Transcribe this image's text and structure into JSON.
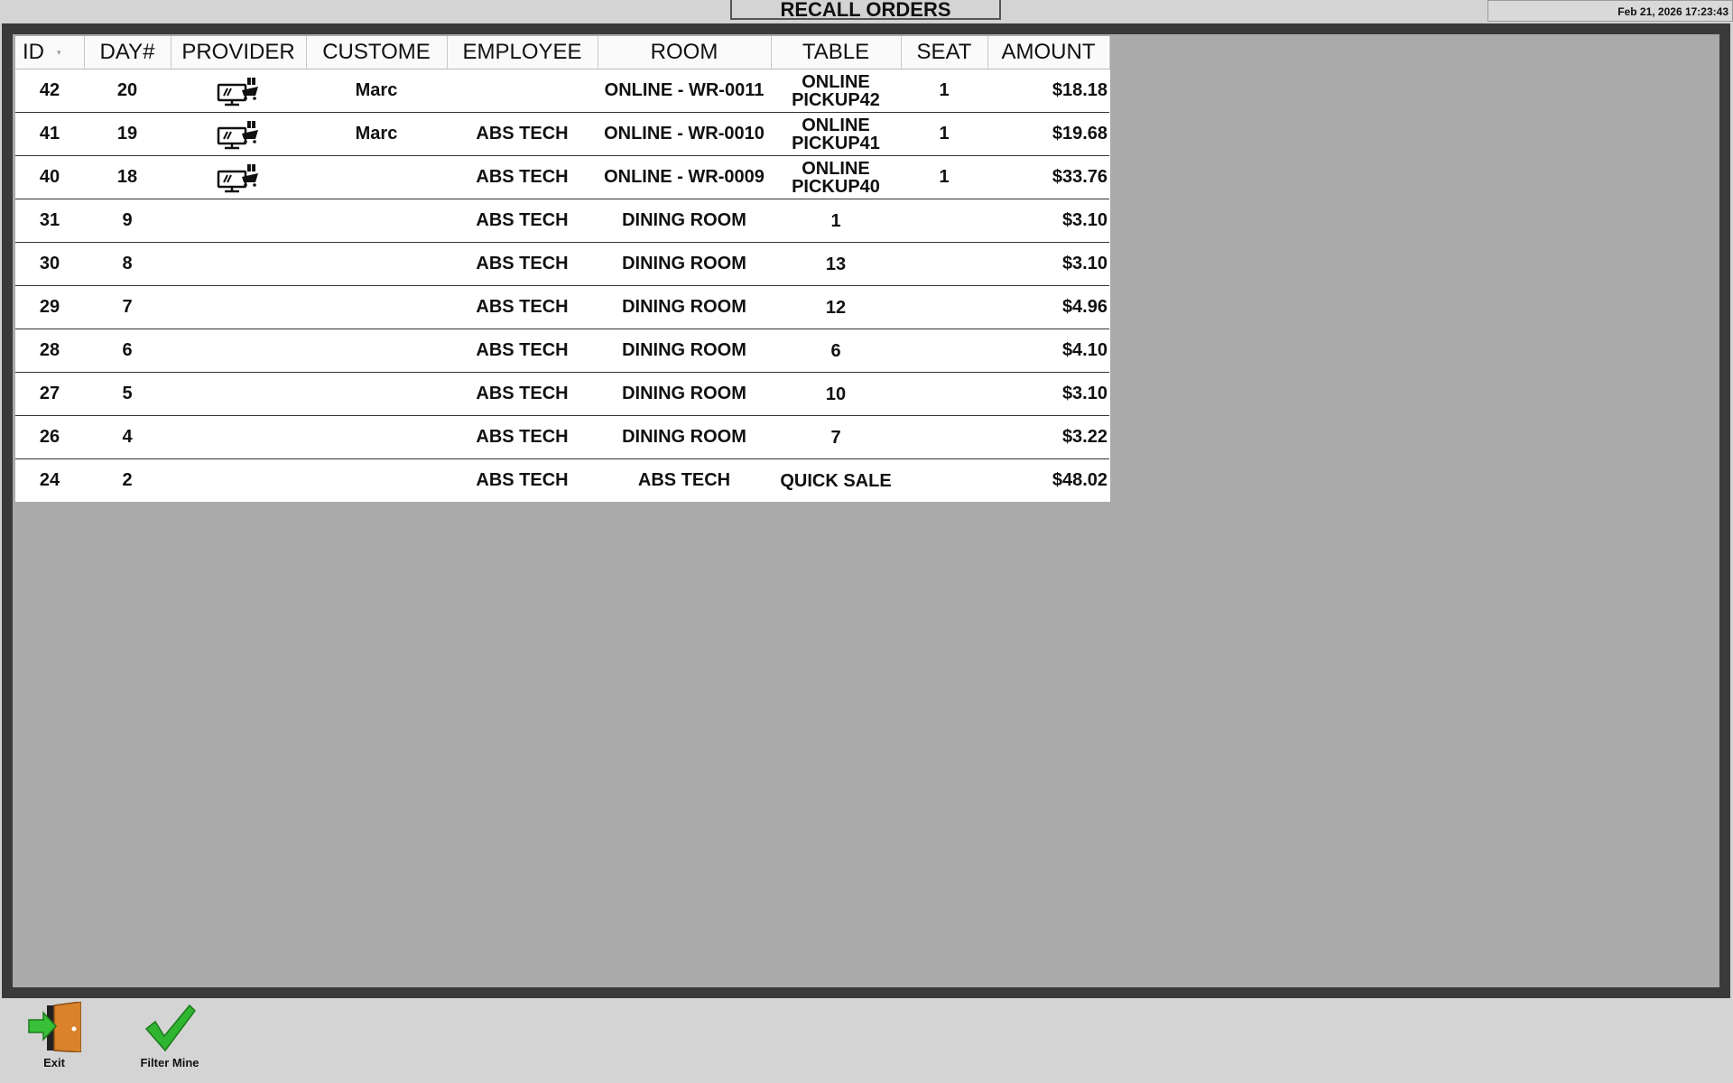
{
  "header": {
    "title": "RECALL ORDERS",
    "datetime": "Feb 21, 2026  17:23:43"
  },
  "table": {
    "columns": [
      "ID",
      "DAY#",
      "PROVIDER",
      "CUSTOME",
      "EMPLOYEE",
      "ROOM",
      "TABLE",
      "SEAT",
      "AMOUNT"
    ],
    "rows": [
      {
        "id": "42",
        "day": "20",
        "provider_icon": "online-order-icon",
        "customer": "Marc",
        "employee": "",
        "room": "ONLINE - WR-0011",
        "table_l1": "ONLINE",
        "table_l2": "PICKUP42",
        "seat": "1",
        "amount": "$18.18"
      },
      {
        "id": "41",
        "day": "19",
        "provider_icon": "online-order-icon",
        "customer": "Marc",
        "employee": "ABS TECH",
        "room": "ONLINE - WR-0010",
        "table_l1": "ONLINE",
        "table_l2": "PICKUP41",
        "seat": "1",
        "amount": "$19.68"
      },
      {
        "id": "40",
        "day": "18",
        "provider_icon": "online-order-icon",
        "customer": "",
        "employee": "ABS TECH",
        "room": "ONLINE - WR-0009",
        "table_l1": "ONLINE",
        "table_l2": "PICKUP40",
        "seat": "1",
        "amount": "$33.76"
      },
      {
        "id": "31",
        "day": "9",
        "provider_icon": "",
        "customer": "",
        "employee": "ABS TECH",
        "room": "DINING ROOM",
        "table_l1": "1",
        "table_l2": "",
        "seat": "",
        "amount": "$3.10"
      },
      {
        "id": "30",
        "day": "8",
        "provider_icon": "",
        "customer": "",
        "employee": "ABS TECH",
        "room": "DINING ROOM",
        "table_l1": "13",
        "table_l2": "",
        "seat": "",
        "amount": "$3.10"
      },
      {
        "id": "29",
        "day": "7",
        "provider_icon": "",
        "customer": "",
        "employee": "ABS TECH",
        "room": "DINING ROOM",
        "table_l1": "12",
        "table_l2": "",
        "seat": "",
        "amount": "$4.96"
      },
      {
        "id": "28",
        "day": "6",
        "provider_icon": "",
        "customer": "",
        "employee": "ABS TECH",
        "room": "DINING ROOM",
        "table_l1": "6",
        "table_l2": "",
        "seat": "",
        "amount": "$4.10"
      },
      {
        "id": "27",
        "day": "5",
        "provider_icon": "",
        "customer": "",
        "employee": "ABS TECH",
        "room": "DINING ROOM",
        "table_l1": "10",
        "table_l2": "",
        "seat": "",
        "amount": "$3.10"
      },
      {
        "id": "26",
        "day": "4",
        "provider_icon": "",
        "customer": "",
        "employee": "ABS TECH",
        "room": "DINING ROOM",
        "table_l1": "7",
        "table_l2": "",
        "seat": "",
        "amount": "$3.22"
      },
      {
        "id": "24",
        "day": "2",
        "provider_icon": "",
        "customer": "",
        "employee": "ABS TECH",
        "room": "ABS TECH",
        "table_l1": "QUICK SALE",
        "table_l2": "",
        "seat": "",
        "amount": "$48.02"
      }
    ]
  },
  "toolbar": {
    "exit_label": "Exit",
    "exit_icon": "exit-door-icon",
    "filter_label": "Filter Mine",
    "filter_icon": "checkmark-icon"
  },
  "colors": {
    "frame": "#3a3a3a",
    "panel": "#aaaaaa",
    "background": "#d4d4d4",
    "check_green": "#2fb52f",
    "door_orange": "#d9822b"
  }
}
